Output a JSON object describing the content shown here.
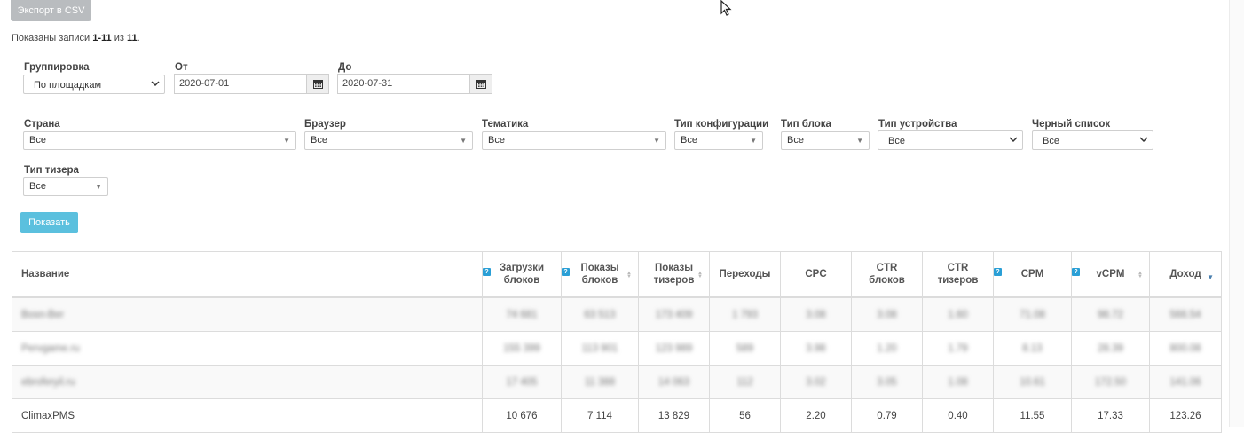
{
  "toolbar": {
    "export_label": "Экспорт в CSV",
    "show_label": "Показать"
  },
  "summary": {
    "prefix": "Показаны записи ",
    "range": "1-11",
    "middle": " из ",
    "total": "11",
    "suffix": "."
  },
  "filters": {
    "grouping": {
      "label": "Группировка",
      "value": "По площадкам"
    },
    "from": {
      "label": "От",
      "value": "2020-07-01"
    },
    "to": {
      "label": "До",
      "value": "2020-07-31"
    },
    "country": {
      "label": "Страна",
      "value": "Все"
    },
    "browser": {
      "label": "Браузер",
      "value": "Все"
    },
    "theme": {
      "label": "Тематика",
      "value": "Все"
    },
    "config_type": {
      "label": "Тип конфигурации",
      "value": "Все"
    },
    "block_type": {
      "label": "Тип блока",
      "value": "Все"
    },
    "device_type": {
      "label": "Тип устройства",
      "value": "Все"
    },
    "blacklist": {
      "label": "Черный список",
      "value": "Все"
    },
    "teaser_type": {
      "label": "Тип тизера",
      "value": "Все"
    }
  },
  "table": {
    "headers": {
      "name": "Название",
      "block_loads": "Загрузки блоков",
      "block_views": "Показы блоков",
      "teaser_views": "Показы тизеров",
      "clicks": "Переходы",
      "cpc": "CPC",
      "ctr_blocks": "CTR блоков",
      "ctr_teasers": "CTR тизеров",
      "cpm": "CPM",
      "vcpm": "vCPM",
      "income": "Доход"
    },
    "rows": [
      [
        "Bosn-Ber",
        "74 681",
        "63 513",
        "173 409",
        "1 793",
        "3.08",
        "3.08",
        "1.60",
        "71.08",
        "98.72",
        "566.54"
      ],
      [
        "Pervgame.ru",
        "155 399",
        "113 901",
        "123 989",
        "589",
        "3.98",
        "1.20",
        "1.79",
        "8.13",
        "28.39",
        "800.08"
      ],
      [
        "ebroferyil.ru",
        "17 405",
        "11 388",
        "14 063",
        "112",
        "3.02",
        "3.05",
        "1.08",
        "10.61",
        "172.50",
        "141.06"
      ],
      [
        "ClimaxPMS",
        "10 676",
        "7 114",
        "13 829",
        "56",
        "2.20",
        "0.79",
        "0.40",
        "11.55",
        "17.33",
        "123.26"
      ]
    ]
  },
  "icons": {
    "help": "?",
    "calendar": "calendar-icon",
    "sort": "sort-icon"
  },
  "colors": {
    "accent": "#5bc0de",
    "help": "#2a9fd6",
    "export_button": "#b9bcbf"
  }
}
